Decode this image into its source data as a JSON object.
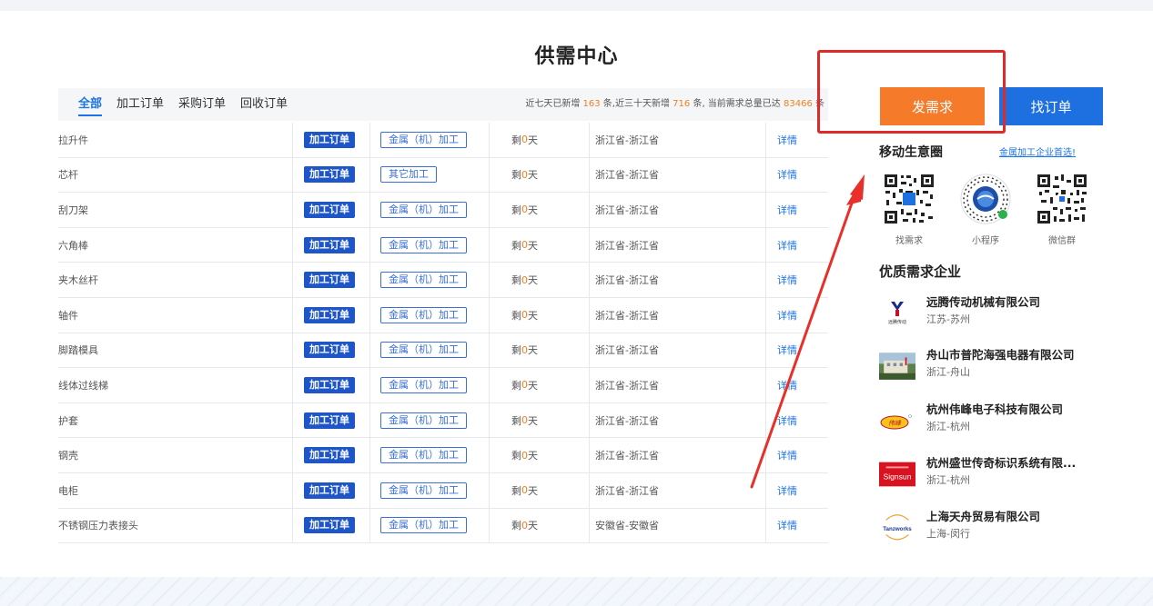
{
  "page_title": "供需中心",
  "tabs": [
    {
      "label": "全部",
      "active": true
    },
    {
      "label": "加工订单",
      "active": false
    },
    {
      "label": "采购订单",
      "active": false
    },
    {
      "label": "回收订单",
      "active": false
    }
  ],
  "stats": {
    "p1": "近七天已新增",
    "week_new": "163",
    "p2": "条,近三十天新增",
    "month_new": "716",
    "p3": "条, 当前需求总量已达",
    "total": "83466",
    "p4": "条"
  },
  "orders": [
    {
      "name": "拉升件",
      "type": "加工订单",
      "category": "金属（机）加工",
      "days_prefix": "剩",
      "days": "0",
      "days_suffix": "天",
      "region": "浙江省-浙江省",
      "detail": "详情"
    },
    {
      "name": "芯杆",
      "type": "加工订单",
      "category": "其它加工",
      "days_prefix": "剩",
      "days": "0",
      "days_suffix": "天",
      "region": "浙江省-浙江省",
      "detail": "详情"
    },
    {
      "name": "刮刀架",
      "type": "加工订单",
      "category": "金属（机）加工",
      "days_prefix": "剩",
      "days": "0",
      "days_suffix": "天",
      "region": "浙江省-浙江省",
      "detail": "详情"
    },
    {
      "name": "六角棒",
      "type": "加工订单",
      "category": "金属（机）加工",
      "days_prefix": "剩",
      "days": "0",
      "days_suffix": "天",
      "region": "浙江省-浙江省",
      "detail": "详情"
    },
    {
      "name": "夹木丝杆",
      "type": "加工订单",
      "category": "金属（机）加工",
      "days_prefix": "剩",
      "days": "0",
      "days_suffix": "天",
      "region": "浙江省-浙江省",
      "detail": "详情"
    },
    {
      "name": "轴件",
      "type": "加工订单",
      "category": "金属（机）加工",
      "days_prefix": "剩",
      "days": "0",
      "days_suffix": "天",
      "region": "浙江省-浙江省",
      "detail": "详情"
    },
    {
      "name": "脚踏模具",
      "type": "加工订单",
      "category": "金属（机）加工",
      "days_prefix": "剩",
      "days": "0",
      "days_suffix": "天",
      "region": "浙江省-浙江省",
      "detail": "详情"
    },
    {
      "name": "线体过线梯",
      "type": "加工订单",
      "category": "金属（机）加工",
      "days_prefix": "剩",
      "days": "0",
      "days_suffix": "天",
      "region": "浙江省-浙江省",
      "detail": "详情"
    },
    {
      "name": "护套",
      "type": "加工订单",
      "category": "金属（机）加工",
      "days_prefix": "剩",
      "days": "0",
      "days_suffix": "天",
      "region": "浙江省-浙江省",
      "detail": "详情"
    },
    {
      "name": "钢壳",
      "type": "加工订单",
      "category": "金属（机）加工",
      "days_prefix": "剩",
      "days": "0",
      "days_suffix": "天",
      "region": "浙江省-浙江省",
      "detail": "详情"
    },
    {
      "name": "电柜",
      "type": "加工订单",
      "category": "金属（机）加工",
      "days_prefix": "剩",
      "days": "0",
      "days_suffix": "天",
      "region": "浙江省-浙江省",
      "detail": "详情"
    },
    {
      "name": "不锈钢压力表接头",
      "type": "加工订单",
      "category": "金属（机）加工",
      "days_prefix": "剩",
      "days": "0",
      "days_suffix": "天",
      "region": "安徽省-安徽省",
      "detail": "详情"
    }
  ],
  "actions": {
    "publish": "发需求",
    "find": "找订单"
  },
  "mobile": {
    "title": "移动生意圈",
    "link": "金属加工企业首选!",
    "qr_labels": [
      "找需求",
      "小程序",
      "微信群"
    ]
  },
  "quality": {
    "title": "优质需求企业",
    "companies": [
      {
        "name": "远腾传动机械有限公司",
        "location": "江苏-苏州",
        "logo_icon": "yuanteng-logo-icon"
      },
      {
        "name": "舟山市普陀海强电器有限公司",
        "location": "浙江-舟山",
        "logo_icon": "factory-photo-icon"
      },
      {
        "name": "杭州伟峰电子科技有限公司",
        "location": "浙江-杭州",
        "logo_icon": "weifeng-logo-icon"
      },
      {
        "name": "杭州盛世传奇标识系统有限...",
        "location": "浙江-杭州",
        "logo_icon": "signsun-logo-icon"
      },
      {
        "name": "上海天舟贸易有限公司",
        "location": "上海-闵行",
        "logo_icon": "tianzhou-logo-icon"
      }
    ]
  },
  "logo_text": {
    "yuanteng": "远腾传动",
    "signsun": "Signsun",
    "tianzhou": "Tanzworks",
    "weifeng": "伟峰"
  },
  "colors": {
    "accent_blue": "#1e6fe0",
    "accent_orange": "#f57a2a",
    "highlight_red": "#e02a2a"
  }
}
